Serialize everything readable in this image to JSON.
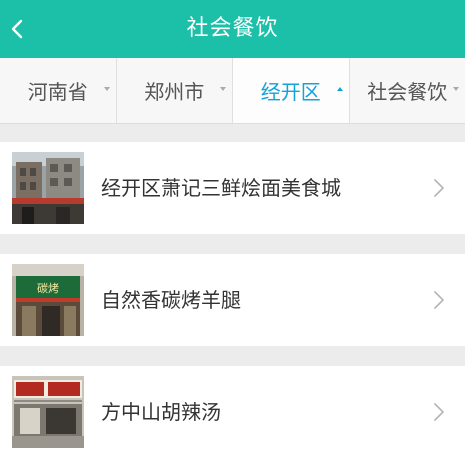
{
  "header": {
    "title": "社会餐饮"
  },
  "filters": [
    {
      "label": "河南省",
      "active": false
    },
    {
      "label": "郑州市",
      "active": false
    },
    {
      "label": "经开区",
      "active": true
    },
    {
      "label": "社会餐饮",
      "active": false
    }
  ],
  "list": [
    {
      "name": "经开区萧记三鲜烩面美食城"
    },
    {
      "name": "自然香碳烤羊腿"
    },
    {
      "name": "方中山胡辣汤"
    }
  ],
  "colors": {
    "header_bg": "#1cc0a8",
    "active_tab": "#12a3d8",
    "page_bg": "#ececec"
  }
}
